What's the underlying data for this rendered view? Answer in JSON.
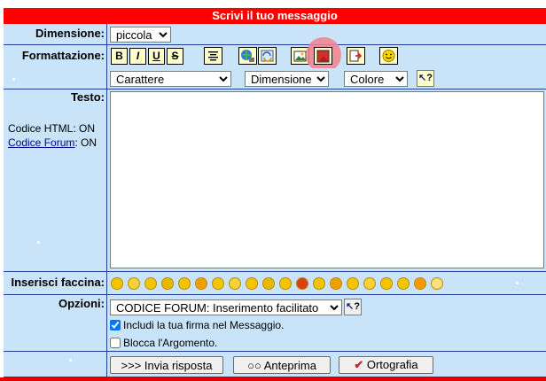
{
  "header": {
    "title": "Scrivi il tuo messaggio"
  },
  "size_row": {
    "label": "Dimensione:",
    "value": "piccola"
  },
  "format_row": {
    "label": "Formattazione:",
    "buttons": [
      "B",
      "I",
      "U",
      "S"
    ],
    "font_select": "Carattere",
    "size_select": "Dimensione",
    "color_select": "Colore",
    "help": "?"
  },
  "text_row": {
    "label": "Testo:",
    "html_code": "Codice HTML: ON",
    "forum_code_link": "Codice Forum",
    "forum_code_state": ": ON",
    "message_value": ""
  },
  "smilies_row": {
    "label": "Inserisci faccina:"
  },
  "options_row": {
    "label": "Opzioni:",
    "mode_select": "CODICE FORUM: Inserimento facilitato",
    "signature_label": "Includi la tua firma nel Messaggio.",
    "signature_checked": true,
    "lock_label": "Blocca l'Argomento.",
    "lock_checked": false,
    "help": "?"
  },
  "actions": {
    "reply": ">>> Invia risposta",
    "preview": "Anteprima",
    "spelling": "Ortografia"
  },
  "colors": {
    "accent_red": "#ff0000",
    "row_blue": "#c9e4f9",
    "border_blue": "#1d3f9e",
    "highlight": "#f2828c"
  }
}
